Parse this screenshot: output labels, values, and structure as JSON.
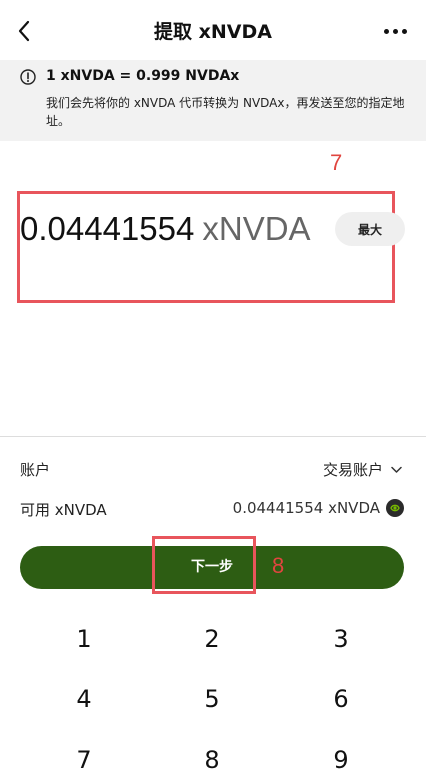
{
  "header": {
    "title": "提取 xNVDA"
  },
  "info": {
    "rate": "1 xNVDA = 0.999 NVDAx",
    "description": "我们会先将你的 xNVDA 代币转换为 NVDAx，再发送至您的指定地址。"
  },
  "annotations": {
    "marker_top": "7",
    "marker_bottom": "8"
  },
  "amount": {
    "value": "0.04441554",
    "unit": "xNVDA",
    "max_label": "最大"
  },
  "account": {
    "label": "账户",
    "value": "交易账户"
  },
  "available": {
    "label": "可用 xNVDA",
    "value": "0.04441554 xNVDA"
  },
  "next_button": {
    "label": "下一步"
  },
  "keypad": {
    "keys": [
      "1",
      "2",
      "3",
      "4",
      "5",
      "6",
      "7",
      "8",
      "9"
    ]
  },
  "colors": {
    "accent_green": "#2d5d13",
    "highlight_red": "#e8555c"
  }
}
